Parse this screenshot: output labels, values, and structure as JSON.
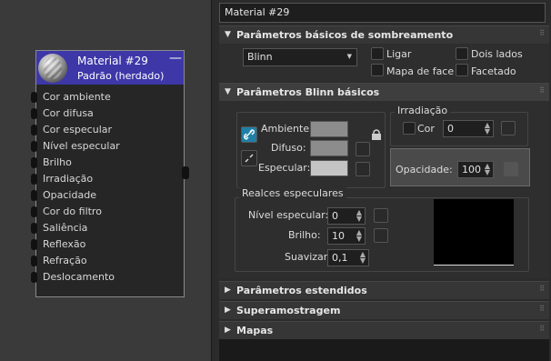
{
  "node": {
    "title": "Material #29",
    "subtitle": "Padrão (herdado)",
    "collapse_glyph": "—",
    "slots": [
      "Cor ambiente",
      "Cor difusa",
      "Cor especular",
      "Nível especular",
      "Brilho",
      "Irradiação",
      "Opacidade",
      "Cor do filtro",
      "Saliência",
      "Reflexão",
      "Refração",
      "Deslocamento"
    ]
  },
  "panel": {
    "title": "Material #29",
    "rollouts": {
      "basic_shading": "Parâmetros básicos de sombreamento",
      "blinn_basic": "Parâmetros Blinn básicos",
      "extended": "Parâmetros estendidos",
      "supersampling": "Superamostragem",
      "maps": "Mapas"
    },
    "shading": {
      "shader_value": "Blinn",
      "wire_label": "Ligar",
      "two_sided_label": "Dois lados",
      "face_map_label": "Mapa de face",
      "faceted_label": "Facetado"
    },
    "blinn": {
      "ambient_label": "Ambiente:",
      "diffuse_label": "Difuso:",
      "specular_label": "Especular:",
      "self_illum_group": "Irradiação",
      "color_label": "Cor",
      "self_illum_value": "0",
      "opacity_label": "Opacidade:",
      "opacity_value": "100",
      "specular_highlights_group": "Realces especulares",
      "spec_level_label": "Nível especular:",
      "spec_level_value": "0",
      "glossiness_label": "Brilho:",
      "glossiness_value": "10",
      "soften_label": "Suavizar:",
      "soften_value": "0,1"
    },
    "colors": {
      "ambient": "#8c8c8c",
      "diffuse": "#8c8c8c",
      "specular": "#c4c4c4",
      "node_header": "#3d37a8",
      "link_icon": "#1f7fa6"
    },
    "icons": {
      "arrow_expanded": "▼",
      "arrow_collapsed": "▶",
      "grip": "⠿",
      "lock": "lock-icon",
      "link": "link-icon",
      "unlink": "unlink-icon"
    }
  }
}
